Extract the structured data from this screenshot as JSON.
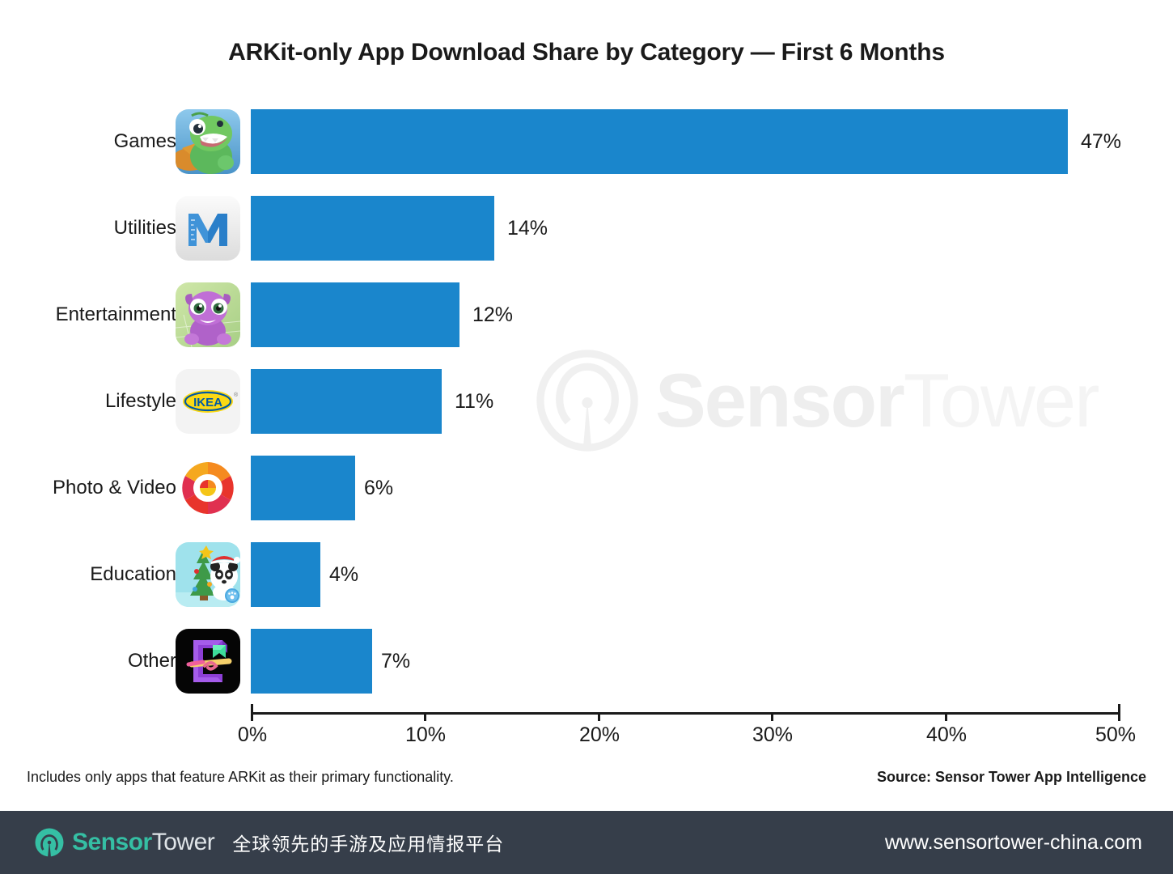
{
  "chart_data": {
    "type": "bar",
    "orientation": "horizontal",
    "title": "ARKit-only App Download Share by Category — First 6 Months",
    "xlabel": "",
    "ylabel": "",
    "xlim": [
      0,
      50
    ],
    "categories": [
      "Games",
      "Utilities",
      "Entertainment",
      "Lifestyle",
      "Photo & Video",
      "Education",
      "Other"
    ],
    "values": [
      47,
      14,
      12,
      11,
      6,
      4,
      7
    ],
    "value_labels": [
      "47%",
      "14%",
      "12%",
      "11%",
      "6%",
      "4%",
      "7%"
    ],
    "tick_values": [
      0,
      10,
      20,
      30,
      40,
      50
    ],
    "tick_labels": [
      "0%",
      "10%",
      "20%",
      "30%",
      "40%",
      "50%"
    ],
    "grid": false,
    "legend": null,
    "bar_color": "#1a86cc",
    "category_icons": [
      "games-dragon-app-icon",
      "utilities-measure-app-icon",
      "entertainment-creature-app-icon",
      "lifestyle-ikea-app-icon",
      "photo-video-ring-app-icon",
      "education-panda-app-icon",
      "other-black-app-icon"
    ]
  },
  "notes": {
    "footnote": "Includes only apps that feature ARKit as their primary functionality.",
    "source": "Source: Sensor Tower App Intelligence"
  },
  "watermark": {
    "brand_first": "Sensor",
    "brand_second": "Tower"
  },
  "footer": {
    "brand_first": "Sensor",
    "brand_second": "Tower",
    "tagline": "全球领先的手游及应用情报平台",
    "url": "www.sensortower-china.com",
    "background": "#363e4a",
    "accent": "#35bfa4"
  }
}
